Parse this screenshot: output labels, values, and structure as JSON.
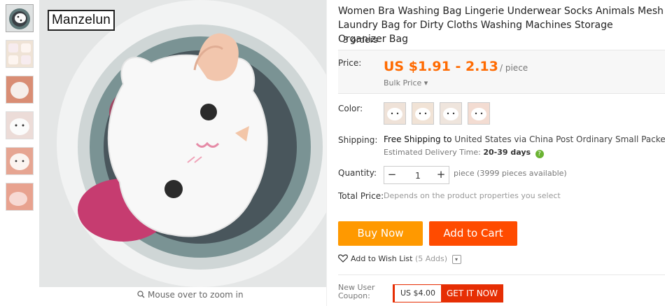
{
  "brand": "Manzelun",
  "zoom_hint": "Mouse over to zoom in",
  "product": {
    "title": "Women Bra Washing Bag Lingerie Underwear Socks Animals Mesh Laundry Bag for Dirty Cloths Washing Machines Storage Organizer Bag",
    "orders": "3 orders"
  },
  "price": {
    "label": "Price:",
    "value": "US $1.91 - 2.13",
    "unit": "/ piece",
    "bulk": "Bulk Price",
    "accent_color": "#ff6a00"
  },
  "color": {
    "label": "Color:",
    "swatches": [
      "cat-face-1",
      "cat-face-2",
      "cat-face-3",
      "cat-face-4"
    ]
  },
  "shipping": {
    "label": "Shipping:",
    "free": "Free Shipping",
    "to": "to",
    "destination": "United States via China Post Ordinary Small Packet Plus",
    "estimated_label": "Estimated Delivery Time:",
    "estimated_value": "20-39 days",
    "help_icon": "?"
  },
  "quantity": {
    "label": "Quantity:",
    "value": "1",
    "minus": "−",
    "plus": "+",
    "note": "piece (3999 pieces available)"
  },
  "total": {
    "label": "Total Price:",
    "note": "Depends on the product properties you select"
  },
  "actions": {
    "buy_now": "Buy Now",
    "add_to_cart": "Add to Cart",
    "buy_color": "#ff9900",
    "cart_color": "#ff4b00"
  },
  "wishlist": {
    "label": "Add to Wish List",
    "count": "(5 Adds)"
  },
  "coupon": {
    "label": "New User Coupon:",
    "amount": "US $4.00",
    "button": "GET IT NOW"
  }
}
